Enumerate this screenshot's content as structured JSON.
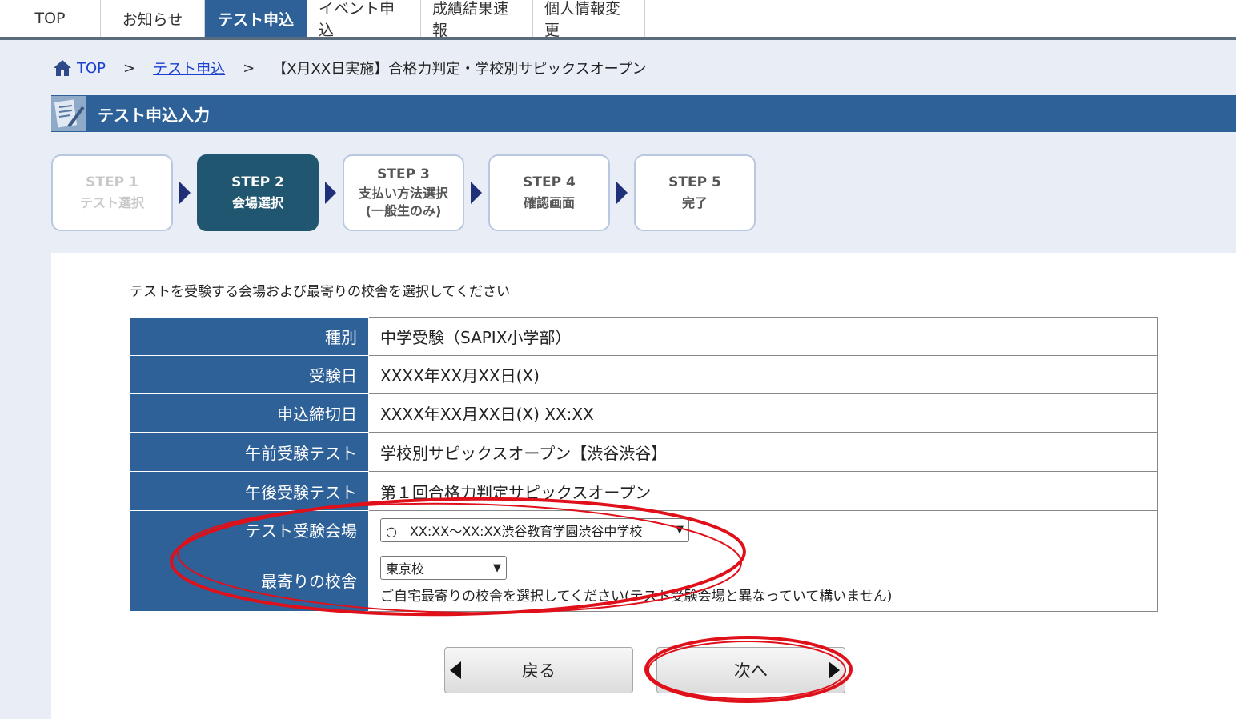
{
  "nav": {
    "tabs": [
      {
        "label": "TOP"
      },
      {
        "label": "お知らせ"
      },
      {
        "label": "テスト申込"
      },
      {
        "label": "イベント申込"
      },
      {
        "label": "成績結果速報"
      },
      {
        "label": "個人情報変更"
      }
    ]
  },
  "breadcrumb": {
    "home": "TOP",
    "sep": ">",
    "parent": "テスト申込",
    "current": "【X月XX日実施】合格力判定・学校別サピックスオープン"
  },
  "section": {
    "title": "テスト申込入力"
  },
  "steps": [
    {
      "label": "STEP 1",
      "sub": "テスト選択"
    },
    {
      "label": "STEP 2",
      "sub": "会場選択"
    },
    {
      "label": "STEP 3",
      "sub": "支払い方法選択",
      "sub2": "(一般生のみ)"
    },
    {
      "label": "STEP 4",
      "sub": "確認画面"
    },
    {
      "label": "STEP 5",
      "sub": "完了"
    }
  ],
  "instruction": "テストを受験する会場および最寄りの校舎を選択してください",
  "form": {
    "type_label": "種別",
    "type_value": "中学受験（SAPIX小学部）",
    "date_label": "受験日",
    "date_value": "XXXX年XX月XX日(X)",
    "deadline_label": "申込締切日",
    "deadline_value": "XXXX年XX月XX日(X) XX:XX",
    "am_label": "午前受験テスト",
    "am_value": "学校別サピックスオープン【渋谷渋谷】",
    "pm_label": "午後受験テスト",
    "pm_value": "第１回合格力判定サピックスオープン",
    "venue_label": "テスト受験会場",
    "venue_value": "○　XX:XX～XX:XX渋谷教育学園渋谷中学校",
    "school_label": "最寄りの校舎",
    "school_value": "東京校",
    "school_note": "ご自宅最寄りの校舎を選択してください(テスト受験会場と異なっていて構いません)"
  },
  "buttons": {
    "back": "戻る",
    "next": "次へ"
  },
  "colors": {
    "primary": "#2e6198",
    "active_step": "#20566f",
    "annotation": "#e0101a"
  }
}
